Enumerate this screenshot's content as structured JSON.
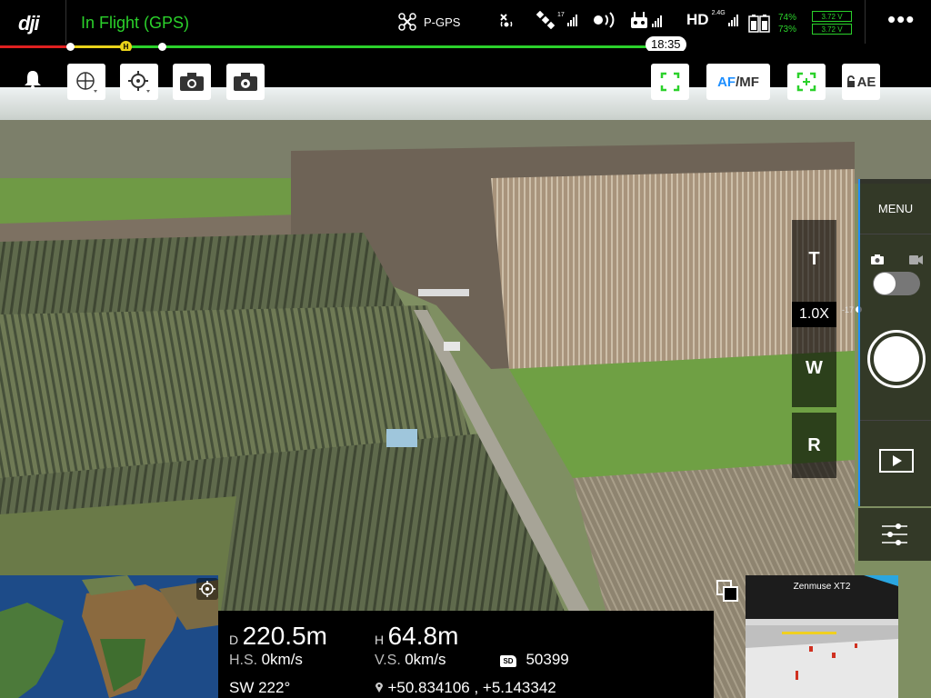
{
  "app": {
    "logo": "dji"
  },
  "status_bar": {
    "flight_status": "In Flight (GPS)",
    "gps_mode": "P-GPS",
    "satellite_count": "17",
    "hd_label": "HD",
    "hd_band": "2.4G",
    "battery": {
      "pct_aircraft": "74%",
      "pct_remote": "73%",
      "volt_1": "3.72 V",
      "volt_2": "3.72 V"
    },
    "colors": {
      "accent": "#2bd12b",
      "warn": "#e9d21a",
      "danger": "#e02020"
    }
  },
  "timebar": {
    "remaining_time": "18:35",
    "home_marker": "H"
  },
  "toolbar": {
    "af_mf": {
      "af": "AF",
      "mf": "/MF"
    },
    "ae_lock": "AE"
  },
  "camera_panel": {
    "zoom_tele": "T",
    "zoom_value": "1.0X",
    "zoom_wide": "W",
    "reset": "R",
    "menu": "MENU",
    "ev_label": "-17"
  },
  "telemetry": {
    "distance_label": "D",
    "distance": "220.5m",
    "height_label": "H",
    "height": "64.8m",
    "hs_label": "H.S.",
    "hs": "0km/s",
    "vs_label": "V.S.",
    "vs": "0km/s",
    "sd_label": "SD",
    "sd_remaining": "50399",
    "heading": "SW 222°",
    "coordinates": "+50.834106 , +5.143342"
  },
  "mini_view": {
    "camera_name": "Zenmuse XT2"
  }
}
